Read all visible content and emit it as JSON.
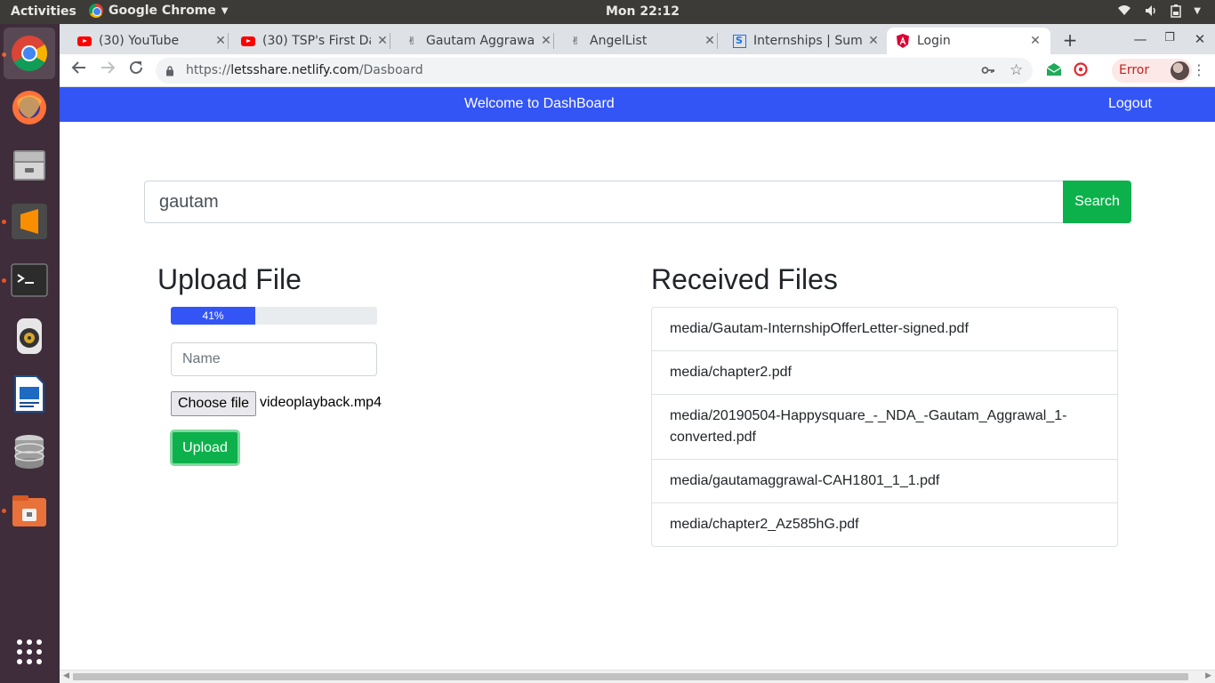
{
  "os": {
    "activities": "Activities",
    "app_name": "Google Chrome",
    "clock": "Mon 22:12",
    "indicators": [
      "wifi-icon",
      "volume-icon",
      "battery-icon",
      "power-icon"
    ]
  },
  "dock": {
    "items": [
      "chrome-icon",
      "firefox-icon",
      "files-icon",
      "sublime-text-icon",
      "terminal-icon",
      "rhythmbox-icon",
      "libreoffice-impress-icon",
      "database-icon",
      "archive-manager-icon"
    ],
    "show_apps": "show-applications-icon"
  },
  "tabs": [
    {
      "title": "(30) YouTube",
      "icon": "youtube-icon"
    },
    {
      "title": "(30) TSP's First Da",
      "icon": "youtube-icon"
    },
    {
      "title": "Gautam Aggrawa",
      "icon": "angellist-icon"
    },
    {
      "title": "AngelList",
      "icon": "angellist-icon"
    },
    {
      "title": "Internships | Sum",
      "icon": "internshala-icon"
    },
    {
      "title": "Login",
      "icon": "angular-icon"
    }
  ],
  "omnibox": {
    "proto": "https://",
    "host": "letsshare.netlify.com",
    "path": "/Dasboard"
  },
  "profile": {
    "error_label": "Error"
  },
  "navbar": {
    "welcome": "Welcome to DashBoard",
    "logout": "Logout"
  },
  "search": {
    "value": "gautam",
    "button": "Search"
  },
  "upload": {
    "title": "Upload File",
    "progress_percent": 41,
    "progress_label": "41%",
    "name_placeholder": "Name",
    "choose_file": "Choose file",
    "file_name": "videoplayback.mp4",
    "button": "Upload"
  },
  "received": {
    "title": "Received Files",
    "files": [
      "media/Gautam-InternshipOfferLetter-signed.pdf",
      "media/chapter2.pdf",
      "media/20190504-Happysquare_-_NDA_-Gautam_Aggrawal_1-converted.pdf",
      "media/gautamaggrawal-CAH1801_1_1.pdf",
      "media/chapter2_Az585hG.pdf"
    ]
  },
  "colors": {
    "primary": "#3455f5",
    "success": "#0db14b"
  }
}
